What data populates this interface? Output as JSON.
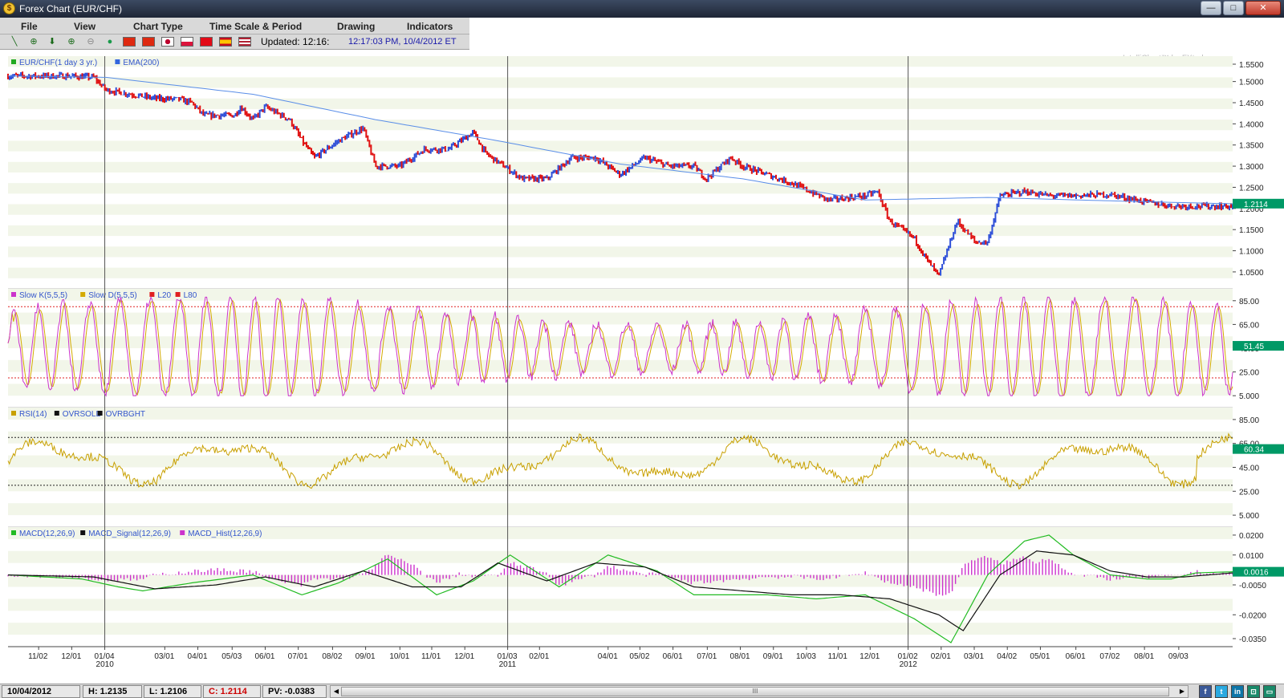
{
  "window": {
    "title": "Forex Chart (EUR/CHF)",
    "app_icon": "fxtrek-coin-icon",
    "min_label": "—",
    "max_label": "□",
    "close_label": "✕"
  },
  "menu": [
    "File",
    "View",
    "Chart Type",
    "Time Scale & Period",
    "Drawing",
    "Indicators"
  ],
  "toolbar": {
    "tools": [
      {
        "icon": "line-tool-icon",
        "glyph": "╲"
      },
      {
        "icon": "crosshair-icon",
        "glyph": "⊕"
      },
      {
        "icon": "arrow-down-icon",
        "glyph": "⬇"
      },
      {
        "icon": "zoom-in-icon",
        "glyph": "⊕"
      },
      {
        "icon": "zoom-out-icon",
        "glyph": "⊖"
      },
      {
        "icon": "globe-icon",
        "glyph": "●"
      }
    ],
    "flags": [
      "china",
      "hong-kong",
      "japan",
      "poland",
      "turkey",
      "spain",
      "usa"
    ],
    "updated_label": "Updated: 12:16:",
    "timestamp": "12:17:03 PM, 10/4/2012 ET"
  },
  "colors": {
    "bg_band": "#f2f6e9",
    "up": "#2e4fd8",
    "down": "#e01010",
    "ema": "#5a8ee8",
    "slowk": "#cc33cc",
    "slowd": "#d4aa00",
    "rsi": "#c8a000",
    "macd": "#22bb22",
    "signal": "#111111",
    "hist": "#cc33cc",
    "ref_red": "#e02020",
    "label_green": "#009966"
  },
  "watermark": "IntelliChart™ by FXtrek.com",
  "status": {
    "date": "10/04/2012",
    "high": "H: 1.2135",
    "low": "L: 1.2106",
    "close": "C: 1.2114",
    "pv": "PV: -0.0383",
    "scroll_grip": "III",
    "social": [
      {
        "name": "facebook-icon",
        "glyph": "f",
        "color": "#3b5998"
      },
      {
        "name": "twitter-icon",
        "glyph": "t",
        "color": "#2aa9e0"
      },
      {
        "name": "linkedin-icon",
        "glyph": "in",
        "color": "#0e76a8"
      },
      {
        "name": "share-icon",
        "glyph": "⊡",
        "color": "#1a8a6a"
      },
      {
        "name": "window-icon",
        "glyph": "▭",
        "color": "#1a8a6a"
      }
    ]
  },
  "chart_data": [
    {
      "type": "line",
      "panel": "price",
      "legend": [
        {
          "name": "EUR/CHF(1 day  3 yr.)",
          "color": "#22aa22"
        },
        {
          "name": "EMA(200)",
          "color": "#3366dd"
        }
      ],
      "y_ticks": [
        "1.5500",
        "1.5000",
        "1.4500",
        "1.4000",
        "1.3500",
        "1.3000",
        "1.2500",
        "1.2000",
        "1.1500",
        "1.1000",
        "1.0500"
      ],
      "ylim": [
        1.01,
        1.56
      ],
      "last_value": "1.2114",
      "series_keypoints": {
        "price": [
          [
            0,
            1.513
          ],
          [
            0.05,
            1.513
          ],
          [
            0.07,
            1.51
          ],
          [
            0.08,
            1.48
          ],
          [
            0.1,
            1.47
          ],
          [
            0.12,
            1.46
          ],
          [
            0.14,
            1.458
          ],
          [
            0.15,
            1.45
          ],
          [
            0.16,
            1.42
          ],
          [
            0.185,
            1.42
          ],
          [
            0.19,
            1.44
          ],
          [
            0.2,
            1.41
          ],
          [
            0.21,
            1.44
          ],
          [
            0.23,
            1.41
          ],
          [
            0.24,
            1.36
          ],
          [
            0.25,
            1.32
          ],
          [
            0.27,
            1.36
          ],
          [
            0.29,
            1.39
          ],
          [
            0.3,
            1.3
          ],
          [
            0.32,
            1.3
          ],
          [
            0.34,
            1.34
          ],
          [
            0.36,
            1.34
          ],
          [
            0.38,
            1.38
          ],
          [
            0.39,
            1.33
          ],
          [
            0.42,
            1.27
          ],
          [
            0.44,
            1.27
          ],
          [
            0.46,
            1.32
          ],
          [
            0.48,
            1.32
          ],
          [
            0.5,
            1.28
          ],
          [
            0.52,
            1.32
          ],
          [
            0.54,
            1.3
          ],
          [
            0.56,
            1.3
          ],
          [
            0.57,
            1.27
          ],
          [
            0.59,
            1.32
          ],
          [
            0.6,
            1.3
          ],
          [
            0.64,
            1.26
          ],
          [
            0.67,
            1.22
          ],
          [
            0.7,
            1.23
          ],
          [
            0.71,
            1.24
          ],
          [
            0.72,
            1.17
          ],
          [
            0.74,
            1.13
          ],
          [
            0.75,
            1.08
          ],
          [
            0.76,
            1.04
          ],
          [
            0.775,
            1.17
          ],
          [
            0.79,
            1.12
          ],
          [
            0.8,
            1.12
          ],
          [
            0.81,
            1.23
          ],
          [
            0.83,
            1.24
          ],
          [
            0.85,
            1.23
          ],
          [
            0.87,
            1.23
          ],
          [
            0.9,
            1.233
          ],
          [
            0.93,
            1.215
          ],
          [
            0.95,
            1.206
          ],
          [
            1.0,
            1.205
          ]
        ],
        "ema": [
          [
            0,
            1.513
          ],
          [
            0.08,
            1.51
          ],
          [
            0.2,
            1.47
          ],
          [
            0.3,
            1.41
          ],
          [
            0.4,
            1.36
          ],
          [
            0.5,
            1.305
          ],
          [
            0.6,
            1.27
          ],
          [
            0.7,
            1.22
          ],
          [
            0.8,
            1.226
          ],
          [
            0.9,
            1.218
          ],
          [
            1.0,
            1.211
          ]
        ]
      },
      "bands": true
    },
    {
      "type": "line",
      "panel": "stochastic",
      "legend": [
        {
          "name": "Slow K(5,5,5)",
          "color": "#cc33cc"
        },
        {
          "name": "Slow D(5,5,5)",
          "color": "#d4aa00"
        },
        {
          "name": "L20",
          "color": "#e02020"
        },
        {
          "name": "L80",
          "color": "#e02020"
        }
      ],
      "y_ticks": [
        "85.00",
        "65.00",
        "45.00",
        "25.00",
        "5.000"
      ],
      "ylim": [
        -5,
        95
      ],
      "reference_lines": [
        80,
        20
      ],
      "last_value": "51.45",
      "oscillation_cycles": 46
    },
    {
      "type": "line",
      "panel": "rsi",
      "legend": [
        {
          "name": "RSI(14)",
          "color": "#c8a000"
        },
        {
          "name": "OVRSOLD",
          "color": "#111111"
        },
        {
          "name": "OVRBGHT",
          "color": "#111111"
        }
      ],
      "y_ticks": [
        "85.00",
        "65.00",
        "45.00",
        "25.00",
        "5.000"
      ],
      "ylim": [
        -5,
        95
      ],
      "reference_lines": [
        70,
        30
      ],
      "last_value": "60.34"
    },
    {
      "type": "line",
      "panel": "macd",
      "legend": [
        {
          "name": "MACD(12,26,9)",
          "color": "#22bb22"
        },
        {
          "name": "MACD_Signal(12,26,9)",
          "color": "#111111"
        },
        {
          "name": "MACD_Hist(12,26,9)",
          "color": "#cc33cc"
        }
      ],
      "y_ticks": [
        "0.0200",
        "0.0100",
        "-0.0050",
        "-0.0200",
        "-0.0350"
      ],
      "ylim": [
        -0.036,
        0.024
      ],
      "last_value": "0.0016",
      "series_keypoints": {
        "macd": [
          [
            0,
            0
          ],
          [
            0.06,
            -0.002
          ],
          [
            0.09,
            -0.006
          ],
          [
            0.11,
            -0.008
          ],
          [
            0.15,
            -0.004
          ],
          [
            0.2,
            0
          ],
          [
            0.24,
            -0.01
          ],
          [
            0.27,
            -0.004
          ],
          [
            0.31,
            0.008
          ],
          [
            0.35,
            -0.01
          ],
          [
            0.38,
            -0.003
          ],
          [
            0.41,
            0.01
          ],
          [
            0.45,
            -0.006
          ],
          [
            0.49,
            0.01
          ],
          [
            0.53,
            0.002
          ],
          [
            0.56,
            -0.01
          ],
          [
            0.59,
            -0.01
          ],
          [
            0.62,
            -0.01
          ],
          [
            0.66,
            -0.012
          ],
          [
            0.7,
            -0.01
          ],
          [
            0.74,
            -0.022
          ],
          [
            0.77,
            -0.034
          ],
          [
            0.8,
            0
          ],
          [
            0.83,
            0.017
          ],
          [
            0.85,
            0.02
          ],
          [
            0.87,
            0.01
          ],
          [
            0.9,
            0
          ],
          [
            0.93,
            -0.002
          ],
          [
            0.95,
            -0.002
          ],
          [
            0.97,
            0.001
          ],
          [
            1.0,
            0.0016
          ]
        ],
        "signal": [
          [
            0,
            0
          ],
          [
            0.07,
            -0.001
          ],
          [
            0.12,
            -0.007
          ],
          [
            0.17,
            -0.005
          ],
          [
            0.21,
            -0.001
          ],
          [
            0.25,
            -0.006
          ],
          [
            0.29,
            0.002
          ],
          [
            0.33,
            -0.006
          ],
          [
            0.37,
            -0.006
          ],
          [
            0.4,
            0.006
          ],
          [
            0.44,
            -0.003
          ],
          [
            0.48,
            0.006
          ],
          [
            0.52,
            0.004
          ],
          [
            0.56,
            -0.006
          ],
          [
            0.6,
            -0.008
          ],
          [
            0.64,
            -0.01
          ],
          [
            0.68,
            -0.01
          ],
          [
            0.72,
            -0.012
          ],
          [
            0.76,
            -0.02
          ],
          [
            0.78,
            -0.028
          ],
          [
            0.81,
            0
          ],
          [
            0.84,
            0.012
          ],
          [
            0.87,
            0.01
          ],
          [
            0.9,
            0.002
          ],
          [
            0.93,
            -0.001
          ],
          [
            0.96,
            -0.001
          ],
          [
            1.0,
            0.001
          ]
        ]
      }
    }
  ],
  "x_axis": {
    "labels": [
      "11/02",
      "12/01",
      "01/04",
      "03/01",
      "04/01",
      "05/03",
      "06/01",
      "07/01",
      "08/02",
      "09/01",
      "10/01",
      "11/01",
      "12/01",
      "01/03",
      "02/01",
      "04/01",
      "05/02",
      "06/01",
      "07/01",
      "08/01",
      "09/01",
      "10/03",
      "11/01",
      "12/01",
      "01/02",
      "02/01",
      "03/01",
      "04/02",
      "05/01",
      "06/01",
      "07/02",
      "08/01",
      "09/03"
    ],
    "year_labels": [
      {
        "at": "01/04",
        "text": "2010"
      },
      {
        "at": "01/03",
        "text": "2011"
      },
      {
        "at": "01/02",
        "text": "2012"
      }
    ]
  }
}
